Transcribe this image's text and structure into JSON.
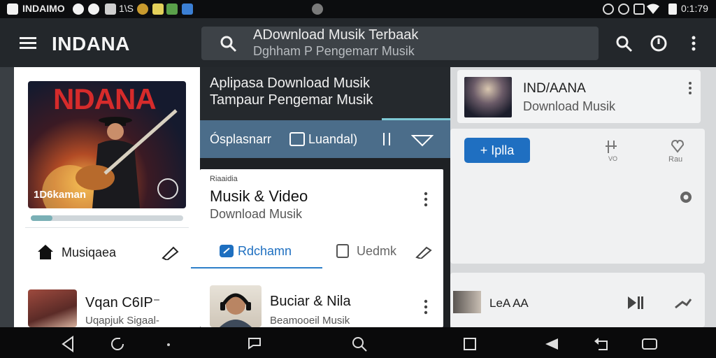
{
  "status_bar": {
    "app_label": "INDAIMO",
    "s1": "1\\S",
    "time": "0:1:79"
  },
  "app_bar": {
    "title": "INDANA",
    "search_query": "ADownload Musik Terbaak",
    "search_suggestion": "Dghham P Pengemarr Musik",
    "icons": [
      "menu-icon",
      "search-icon",
      "power-icon",
      "more-vert-icon"
    ]
  },
  "left_panel": {
    "album_title": "NDANA",
    "album_caption": "1D6kaman",
    "progress": 0.14,
    "tab_label": "Musiqaea",
    "list_item": {
      "title": "Vqan C6IP⁻",
      "subtitle": "Uqapjuk Sigaal-"
    }
  },
  "middle_panel": {
    "header_line1": "Aplipasa Download Musik",
    "header_line2": "Tampaur Pengemar Musik",
    "toolbar": {
      "item1": "Ósplasnarr",
      "item2": "Luandal)"
    },
    "card": {
      "small_label": "Riaaidia",
      "title": "Musik & Video",
      "subtitle": "Download Musik",
      "tab_active": "Rdchamn",
      "tab_other": "Uedmk"
    },
    "list_item": {
      "title": "Buciar & Nila",
      "subtitle": "Beamooeil Musik"
    }
  },
  "right_panel": {
    "card": {
      "title": "IND/AANA",
      "subtitle": "Download Musik"
    },
    "play_button": "+ Iplla",
    "icon1_label": "VO",
    "icon2_label": "Rau",
    "mini_player": {
      "title": "LeA AA"
    }
  },
  "colors": {
    "accent": "#1f6fc1",
    "app_bar": "#23272b",
    "toolbar": "#4b6d8a"
  }
}
